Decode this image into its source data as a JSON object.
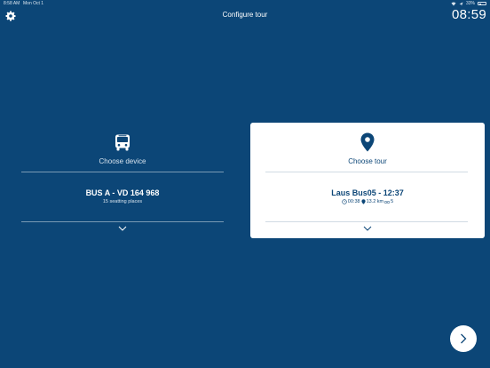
{
  "status_bar": {
    "time": "8:58 AM",
    "date": "Mon Oct 1",
    "battery": "33%"
  },
  "header": {
    "title": "Configure tour",
    "clock": "08:59"
  },
  "device_card": {
    "label": "Choose device",
    "title": "BUS A - VD 164 968",
    "subtitle": "15 seatting places"
  },
  "tour_card": {
    "label": "Choose tour",
    "title": "Laus Bus05 - 12:37",
    "duration": "00:38",
    "distance": "13.2 km",
    "stops": "5"
  },
  "colors": {
    "background": "#0c4677",
    "card": "#ffffff",
    "accent": "#0c4677"
  },
  "icons": {
    "settings": "gear-icon",
    "device": "bus-icon",
    "tour": "map-pin-icon",
    "expand": "chevron-down-icon",
    "next": "chevron-right-icon"
  }
}
